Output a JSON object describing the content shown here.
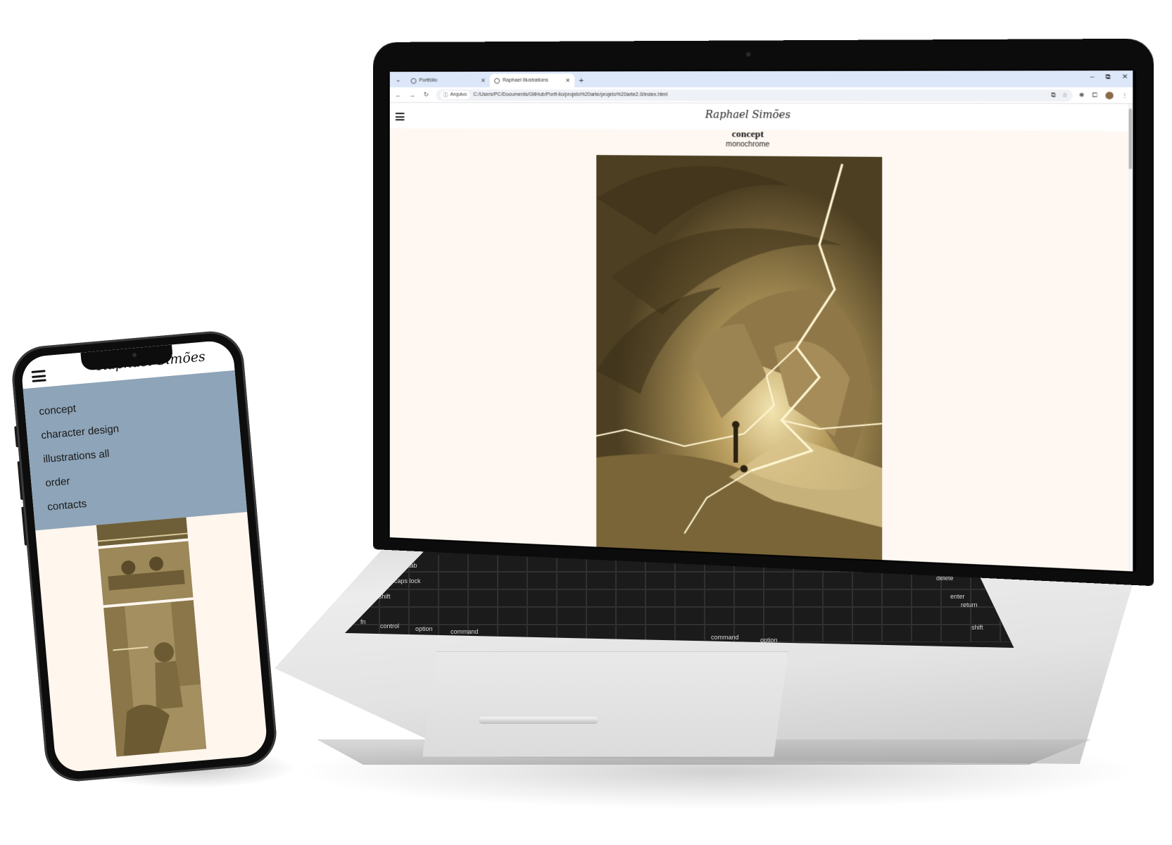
{
  "colors": {
    "page_background": "#fff8f2",
    "mobile_menu_background": "#8ea4b8",
    "tabstrip_background": "#dce7f9",
    "artwork_sepia": "#6e5c34"
  },
  "laptop": {
    "browser": {
      "tabs": [
        {
          "title": "Portfólio",
          "icon": "globe-icon",
          "close": "✕",
          "active": false
        },
        {
          "title": "Raphael Illustrations",
          "icon": "globe-icon",
          "close": "✕",
          "active": true
        }
      ],
      "new_tab_glyph": "+",
      "window_controls": {
        "minimize": "–",
        "restore": "⧉",
        "close": "✕"
      },
      "nav": {
        "back": "←",
        "forward": "→",
        "reload": "↻"
      },
      "address": {
        "chip_label": "Arquivo",
        "url": "C:/Users/PC/Documents/GitHub/Portf-lio/projeto%20arte/projeto%20arte2.0/index.html"
      },
      "toolbar_icons": {
        "translate": "⧉",
        "bookmark": "☆",
        "extension": "✺",
        "puzzle": "⧠",
        "menu": "⋮"
      }
    },
    "page": {
      "brand": "Raphael Simões",
      "section_title": "concept",
      "section_subtitle": "monochrome",
      "artwork_icon": "lightning-rift-illustration"
    },
    "keyboard_labels": {
      "tab": "tab",
      "caps": "caps lock",
      "shift_left": "shift",
      "fn": "fn",
      "control": "control",
      "option_left": "option",
      "command_left": "command",
      "command_right": "command",
      "option_right": "option",
      "delete": "delete",
      "return": "return",
      "enter": "enter",
      "shift_right": "shift"
    }
  },
  "phone": {
    "brand": "Raphael Simões",
    "menu": [
      {
        "label": "concept"
      },
      {
        "label": "character design"
      },
      {
        "label": "illustrations all"
      },
      {
        "label": "order"
      },
      {
        "label": "contacts"
      }
    ]
  }
}
